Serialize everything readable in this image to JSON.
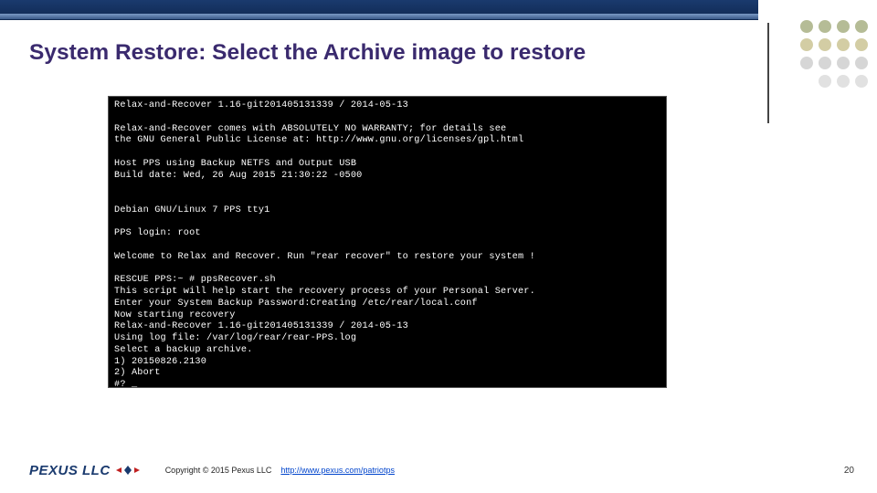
{
  "slide": {
    "title": "System Restore: Select the Archive image to restore",
    "page_number": "20"
  },
  "terminal": {
    "lines": [
      "Relax-and-Recover 1.16-git201405131339 / 2014-05-13",
      "",
      "Relax-and-Recover comes with ABSOLUTELY NO WARRANTY; for details see",
      "the GNU General Public License at: http://www.gnu.org/licenses/gpl.html",
      "",
      "Host PPS using Backup NETFS and Output USB",
      "Build date: Wed, 26 Aug 2015 21:30:22 -0500",
      "",
      "",
      "Debian GNU/Linux 7 PPS tty1",
      "",
      "PPS login: root",
      "",
      "Welcome to Relax and Recover. Run \"rear recover\" to restore your system !",
      "",
      "RESCUE PPS:~ # ppsRecover.sh",
      "This script will help start the recovery process of your Personal Server.",
      "Enter your System Backup Password:Creating /etc/rear/local.conf",
      "Now starting recovery",
      "Relax-and-Recover 1.16-git201405131339 / 2014-05-13",
      "Using log file: /var/log/rear/rear-PPS.log",
      "Select a backup archive.",
      "1) 20150826.2130",
      "2) Abort",
      "#? _"
    ]
  },
  "footer": {
    "company": "PEXUS LLC",
    "copyright": "Copyright © 2015  Pexus LLC",
    "url": "http://www.pexus.com/patriotps"
  }
}
